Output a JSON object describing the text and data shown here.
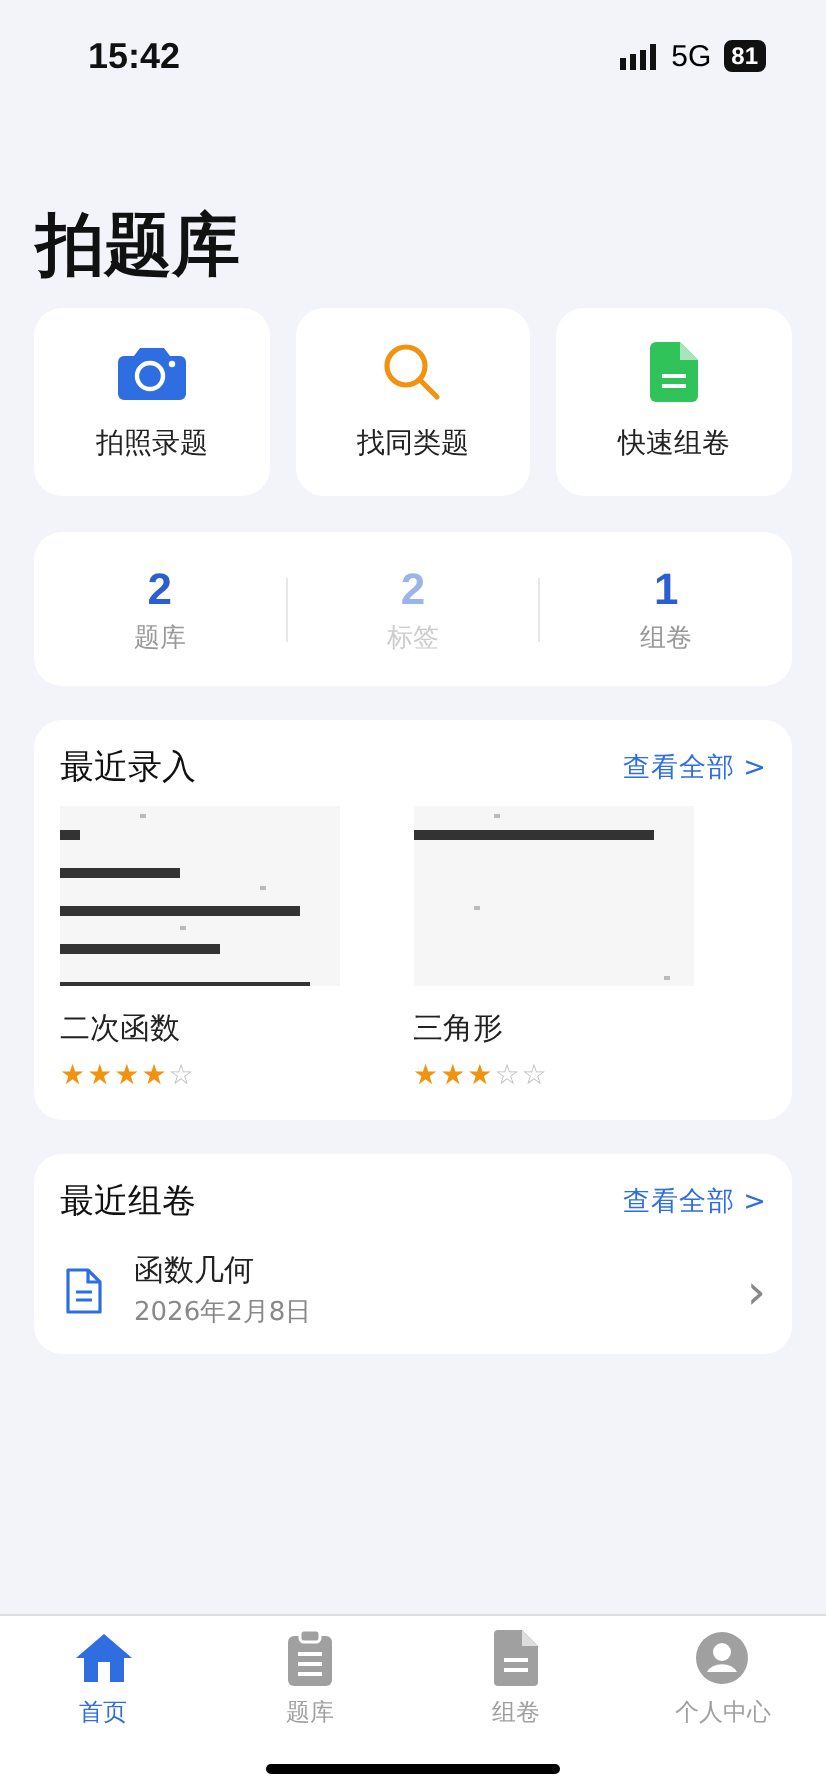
{
  "status_bar": {
    "time": "15:42",
    "network": "5G",
    "battery": "81"
  },
  "title": "拍题库",
  "quick_actions": [
    {
      "kind": "camera",
      "label": "拍照录题"
    },
    {
      "kind": "search",
      "label": "找同类题"
    },
    {
      "kind": "document",
      "label": "快速组卷"
    }
  ],
  "stats": [
    {
      "value": "2",
      "label": "题库",
      "dimmed": false
    },
    {
      "value": "2",
      "label": "标签",
      "dimmed": true
    },
    {
      "value": "1",
      "label": "组卷",
      "dimmed": false
    }
  ],
  "recent_entries": {
    "title": "最近录入",
    "link": "查看全部 >",
    "items": [
      {
        "kind": "picture",
        "name": "二次函数",
        "stars": 4
      },
      {
        "kind": "picture",
        "name": "三角形",
        "stars": 3
      }
    ]
  },
  "recent_papers": {
    "title": "最近组卷",
    "link": "查看全部 >",
    "items": [
      {
        "name": "函数几何",
        "date": "2026年2月8日",
        "chevron": "›"
      }
    ]
  },
  "tabs": [
    {
      "kind": "home",
      "label": "首页",
      "selected": true
    },
    {
      "kind": "clipboard",
      "label": "题库",
      "selected": false
    },
    {
      "kind": "document",
      "label": "组卷",
      "selected": false
    },
    {
      "kind": "person",
      "label": "个人中心",
      "selected": false
    }
  ]
}
